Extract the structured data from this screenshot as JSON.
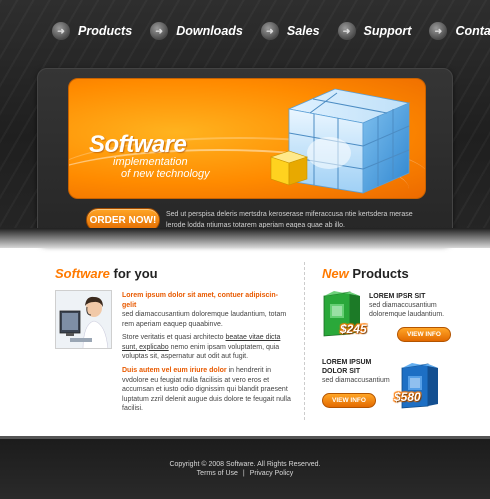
{
  "nav": [
    {
      "label": "Products",
      "icon": "arrow-bullet-icon"
    },
    {
      "label": "Downloads",
      "icon": "arrow-bullet-icon"
    },
    {
      "label": "Sales",
      "icon": "arrow-bullet-icon"
    },
    {
      "label": "Support",
      "icon": "arrow-bullet-icon"
    },
    {
      "label": "Contacts",
      "icon": "arrow-bullet-icon"
    }
  ],
  "banner": {
    "title": "Software",
    "subtitle_line1": "implementation",
    "subtitle_line2": "of new technology",
    "order_label": "ORDER NOW!",
    "text": "Sed ut perspisa deleris mertsdra keroserase miferaccusa ntie kertsdera merase lerode lodda ntiumas totarem aperiam eaqea quae ab illo."
  },
  "about": {
    "title_accent": "Software",
    "title_rest": "for you",
    "intro_lead": "Lorem ipsum dolor sit amet, contuer adipiscin-gelit",
    "intro_text": "sed diamaccusantium doloremque laudantium, totam rem aperiam eaquep quaabinve.",
    "para2_before": "Store veritatis et quasi architecto ",
    "para2_link": "beatae vitae dicta sunt, explicabo",
    "para2_after": " nemo enim ipsam voluptatem, quia voluptas sit, aspernatur aut odit aut fugit.",
    "para3_lead": "Duis autem vel eum iriure dolor",
    "para3_text": " in hendrerit in vvdolore eu feugiat nulla facilisis at vero eros et accumsan et iusto odio dignissim qui blandit praesent luptatum zzril delenit augue duis dolore te feugait nulla facilisi."
  },
  "products": {
    "title_accent": "New",
    "title_rest": "Products",
    "items": [
      {
        "name": "LOREM IPSR SIT",
        "desc": "sed diamaccusantium doloremque laudantium.",
        "price": "$245",
        "button": "VIEW INFO",
        "box_color": "#2aa83a"
      },
      {
        "name_line1": "LOREM IPSUM",
        "name_line2": "DOLOR SIT",
        "desc": "sed diamaccusantium",
        "price": "$580",
        "button": "VIEW INFO",
        "box_color": "#1d6fc4"
      }
    ]
  },
  "footer": {
    "copyright": "Copyright © 2008 Software. All Rights Reserved.",
    "terms": "Terms of Use",
    "separator": "|",
    "privacy": "Privacy Policy"
  },
  "colors": {
    "accent": "#ff7a00",
    "dark_bg": "#262626"
  }
}
